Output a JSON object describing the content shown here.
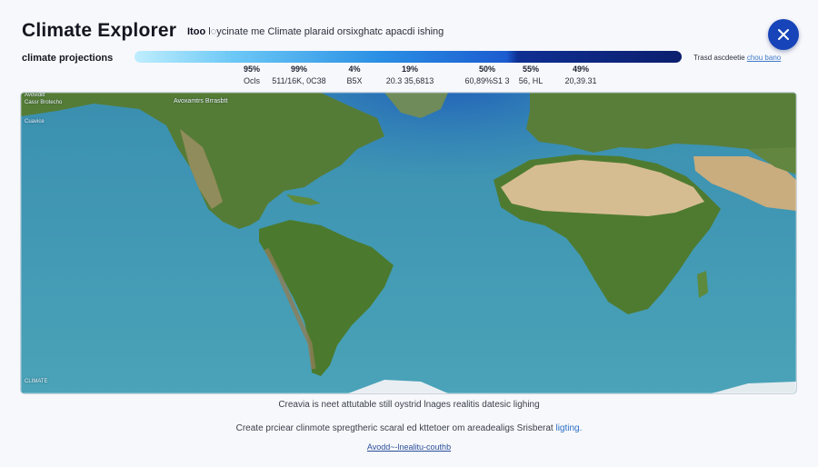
{
  "header": {
    "title": "Climate Explorer",
    "subtitle_lead": "Itoo",
    "subtitle_rest": " l◌ycinate me Climate plaraid orsixghatc apacdi ishing",
    "close_icon": "close-icon"
  },
  "projection": {
    "label": "climate projections",
    "note": "Trasd ascdeetie",
    "note_link": "chou bano"
  },
  "stats": [
    {
      "pct": "95%",
      "val": "Ocls"
    },
    {
      "pct": "99%",
      "val": "511/16K, 0C38"
    },
    {
      "pct": "4%",
      "val": "B5X"
    },
    {
      "pct": "19%",
      "val": "20.3 35,6813"
    },
    {
      "pct": "50%",
      "val": "60,89%S1 3"
    },
    {
      "pct": "55%",
      "val": "56, HL"
    },
    {
      "pct": "49%",
      "val": "20,39.31"
    }
  ],
  "map": {
    "tags": [
      "Avoviditt",
      "Cassr Brotecho",
      "Cuavice",
      "Avoxamtrs Brrasbtt",
      "CLIMATE"
    ]
  },
  "captions": {
    "line1": "Creavia is neet attutable still oystrid lnages realitis datesic lighing",
    "line2": "Create prciear clinmote spregtheric scaral ed kttetoer om areadealigs Srisberat",
    "line2_link": "ligting.",
    "footer_link": "Avodd~-lnealitu-couthb"
  },
  "colors": {
    "accent": "#1744b8",
    "ocean": "#3f98b3",
    "land": "#4e7a34",
    "desert": "#d2b98e"
  }
}
